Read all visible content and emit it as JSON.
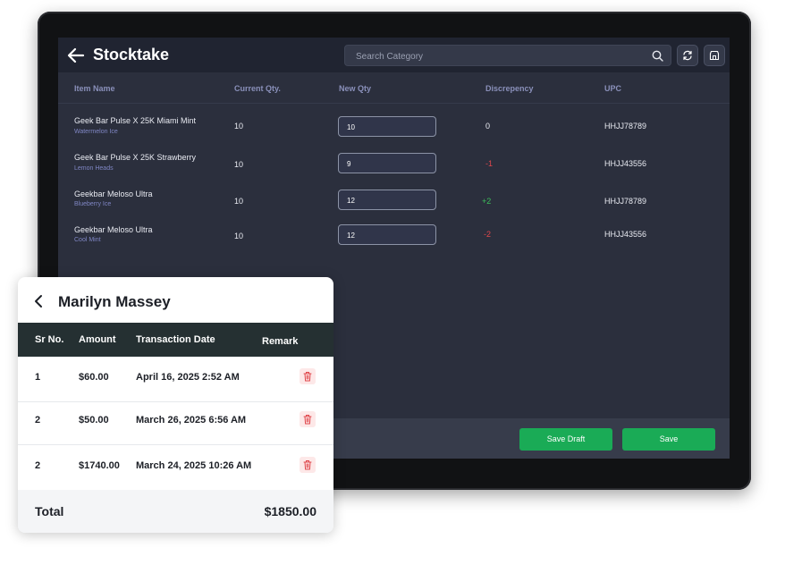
{
  "screen": {
    "title": "Stocktake",
    "search_placeholder": "Search Category",
    "columns": [
      "Item Name",
      "Current Qty.",
      "New Qty",
      "Discrepency",
      "UPC"
    ],
    "rows": [
      {
        "name": "Geek Bar Pulse X 25K Miami Mint",
        "variant": "Watermelon Ice",
        "current_qty": "10",
        "new_qty": "10",
        "discrepancy": "0",
        "upc": "HHJJ78789"
      },
      {
        "name": "Geek Bar Pulse X 25K Strawberry",
        "variant": "Lemon Heads",
        "current_qty": "10",
        "new_qty": "9",
        "discrepancy": "-1",
        "upc": "HHJJ43556"
      },
      {
        "name": "Geekbar Meloso Ultra",
        "variant": "Blueberry Ice",
        "current_qty": "10",
        "new_qty": "12",
        "discrepancy": "+2",
        "upc": "HHJJ78789"
      },
      {
        "name": "Geekbar Meloso Ultra",
        "variant": "Cool Mint",
        "current_qty": "10",
        "new_qty": "12",
        "discrepancy": "-2",
        "upc": "HHJJ43556"
      }
    ],
    "save_draft_label": "Save Draft",
    "save_label": "Save",
    "colors": {
      "positive": "#3dbf5a",
      "negative": "#e0474c",
      "neutral": "#e9ebf2",
      "button": "#1aab56"
    }
  },
  "card": {
    "title": "Marilyn Massey",
    "columns": [
      "Sr No.",
      "Amount",
      "Transaction Date",
      "Remark"
    ],
    "rows": [
      {
        "sr": "1",
        "amount": "$60.00",
        "date": "April 16, 2025 2:52 AM"
      },
      {
        "sr": "2",
        "amount": "$50.00",
        "date": "March 26, 2025 6:56 AM"
      },
      {
        "sr": "2",
        "amount": "$1740.00",
        "date": "March 24, 2025 10:26 AM"
      }
    ],
    "total_label": "Total",
    "total_value": "$1850.00"
  }
}
